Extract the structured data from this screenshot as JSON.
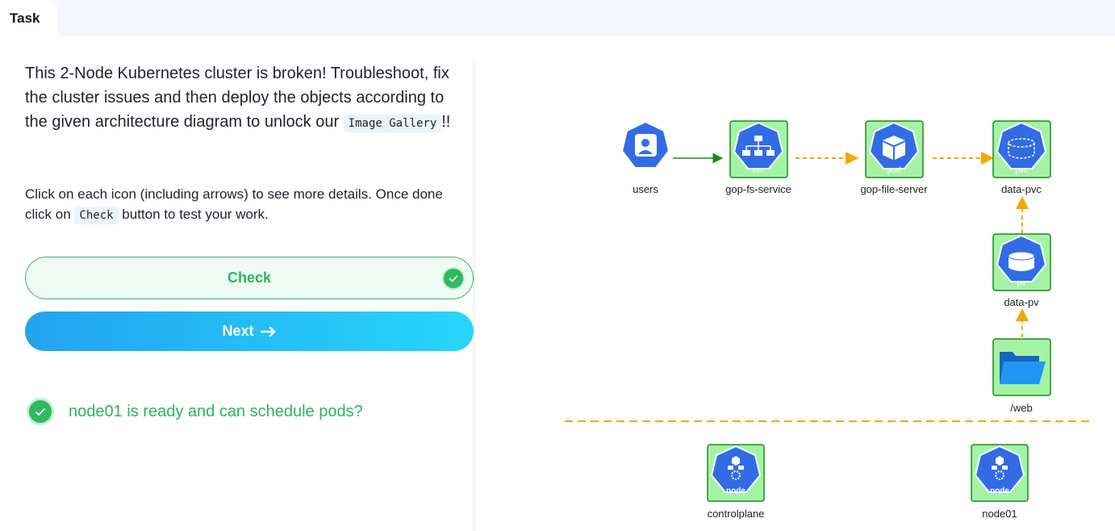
{
  "tabs": {
    "task": "Task"
  },
  "intro": {
    "text_before": "This 2-Node Kubernetes cluster is broken! Troubleshoot, fix the cluster issues and then deploy the objects according to the given architecture diagram to unlock our ",
    "code": "Image Gallery",
    "text_after": "!!"
  },
  "instructions": {
    "text_before": "Click on each icon (including arrows) to see more details. Once done click on ",
    "code": "Check",
    "text_after": " button to test your work."
  },
  "buttons": {
    "check": "Check",
    "next": "Next"
  },
  "results": [
    {
      "text": "node01 is ready and can schedule pods?",
      "status": "passed"
    }
  ],
  "diagram": {
    "nodes": {
      "users": {
        "icon_label": "user",
        "label": "users"
      },
      "service": {
        "icon_label": "svc",
        "label": "gop-fs-service"
      },
      "pod": {
        "icon_label": "pod",
        "label": "gop-file-server"
      },
      "pvc": {
        "icon_label": "pvc",
        "label": "data-pvc"
      },
      "pv": {
        "icon_label": "pv",
        "label": "data-pv"
      },
      "hostpath": {
        "label": "/web"
      },
      "controlplane": {
        "icon_label": "node",
        "label": "controlplane"
      },
      "node01": {
        "icon_label": "node",
        "label": "node01"
      }
    }
  },
  "colors": {
    "k8s_blue": "#326ce5",
    "highlight_green": "#a4f3a4",
    "arrow_orange": "#f5a700",
    "arrow_green": "#1a8a1a",
    "success_green": "#2cb35c"
  }
}
